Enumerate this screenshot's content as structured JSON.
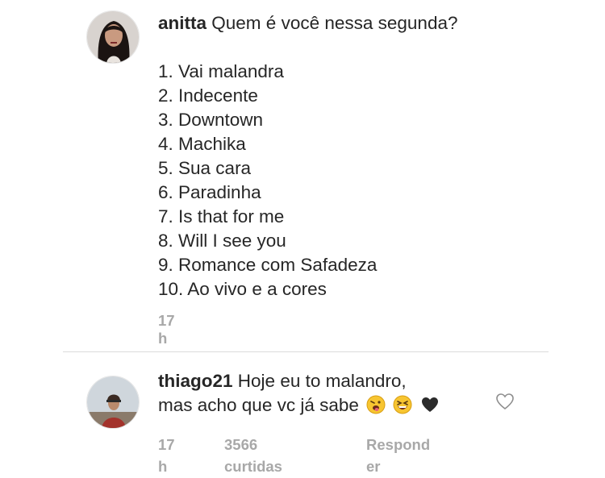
{
  "post": {
    "username": "anitta",
    "text": "Quem é você nessa segunda?",
    "items": [
      "1. Vai malandra",
      "2. Indecente",
      "3. Downtown",
      "4. Machika",
      "5. Sua cara",
      "6. Paradinha",
      "7. Is that for me",
      "8. Will I see you",
      "9. Romance com Safadeza",
      "10. Ao vivo e a cores"
    ],
    "time": "17 h"
  },
  "reply": {
    "username": "thiago21",
    "line1": "Hoje eu to malandro,",
    "line2": "mas acho que vc já sabe",
    "emojis": [
      "face-with-tongue-winking-icon",
      "grinning-squinting-face-icon",
      "black-heart-icon"
    ],
    "time": "17 h",
    "likes": "3566 curtidas",
    "reply_label_part1": "Respond",
    "reply_label_part2": "er"
  },
  "colors": {
    "text": "#262626",
    "meta": "#a8a8a8",
    "divider": "#dbdbdb"
  }
}
